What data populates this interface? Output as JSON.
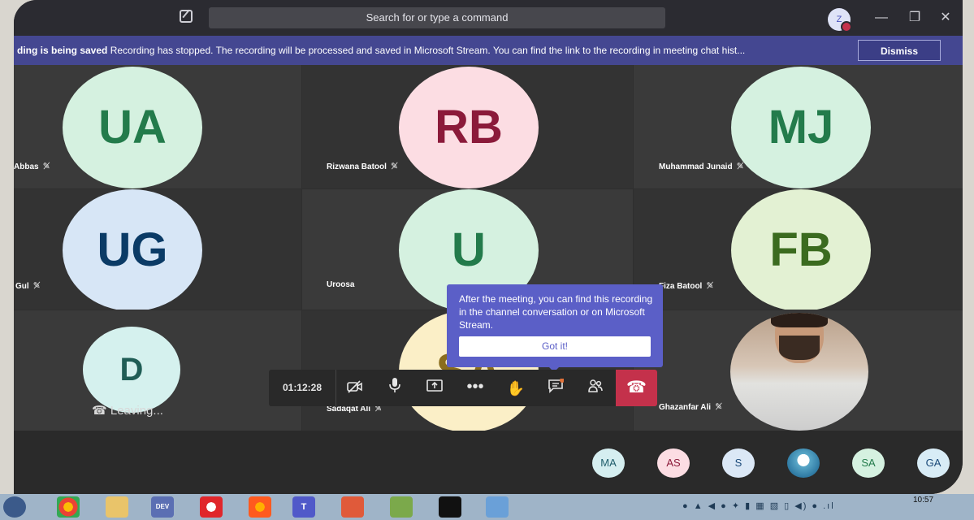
{
  "search": {
    "placeholder": "Search for or type a command"
  },
  "me": {
    "initial": "Z"
  },
  "window": {
    "minimize": "—",
    "restore": "❐",
    "close": "✕"
  },
  "banner": {
    "title": "ding is being saved",
    "message": "Recording has stopped. The recording will be processed and saved in Microsoft Stream. You can find the link to the recording in meeting chat hist...",
    "dismiss": "Dismiss"
  },
  "participants": [
    {
      "initials": "UA",
      "name": "Abbas",
      "muted": true,
      "bg": "#d5f1e0",
      "fg": "#237b4b"
    },
    {
      "initials": "RB",
      "name": "Rizwana Batool",
      "muted": true,
      "bg": "#fcdde3",
      "fg": "#8b1a3a"
    },
    {
      "initials": "MJ",
      "name": "Muhammad Junaid",
      "muted": true,
      "bg": "#d5f1e0",
      "fg": "#237b4b"
    },
    {
      "initials": "UG",
      "name": "Gul",
      "muted": true,
      "bg": "#d7e6f6",
      "fg": "#0b3b66"
    },
    {
      "initials": "U",
      "name": "Uroosa",
      "muted": false,
      "bg": "#d5f1e0",
      "fg": "#237b4b"
    },
    {
      "initials": "FB",
      "name": "Fiza Batool",
      "muted": true,
      "bg": "#e3f1d3",
      "fg": "#3b6b1f"
    },
    {
      "initials": "D",
      "name": "",
      "muted": true,
      "bg": "#d5f1ee",
      "fg": "#1f5d55"
    },
    {
      "initials": "SA",
      "name": "Sadaqat Ali",
      "muted": true,
      "bg": "#fbefc7",
      "fg": "#8a6d1d"
    },
    {
      "initials": "",
      "name": "Ghazanfar Ali",
      "muted": true,
      "bg": "",
      "fg": ""
    }
  ],
  "leaving": "Leaving...",
  "toolbar": {
    "timer": "01:12:28",
    "hangup": "☎"
  },
  "callout": {
    "text": "After the meeting, you can find this recording in the channel conversation or on Microsoft Stream.",
    "button": "Got it!"
  },
  "roster": [
    {
      "initials": "MA",
      "bg": "#d5eef0",
      "fg": "#1f5d6b"
    },
    {
      "initials": "AS",
      "bg": "#fcdde3",
      "fg": "#8b1a3a"
    },
    {
      "initials": "S",
      "bg": "#dbe8f6",
      "fg": "#1b4a7a"
    },
    {
      "initials": "",
      "bg": "#9cb8c8",
      "fg": "#ffffff"
    },
    {
      "initials": "SA",
      "bg": "#d5f1e0",
      "fg": "#237b4b"
    },
    {
      "initials": "GA",
      "bg": "#d8ecf6",
      "fg": "#1b4a7a"
    }
  ],
  "taskbar": {
    "clock": "10:57"
  },
  "colors": {
    "accent": "#5b5fc7",
    "banner": "#444791",
    "hangup": "#c4314b"
  }
}
